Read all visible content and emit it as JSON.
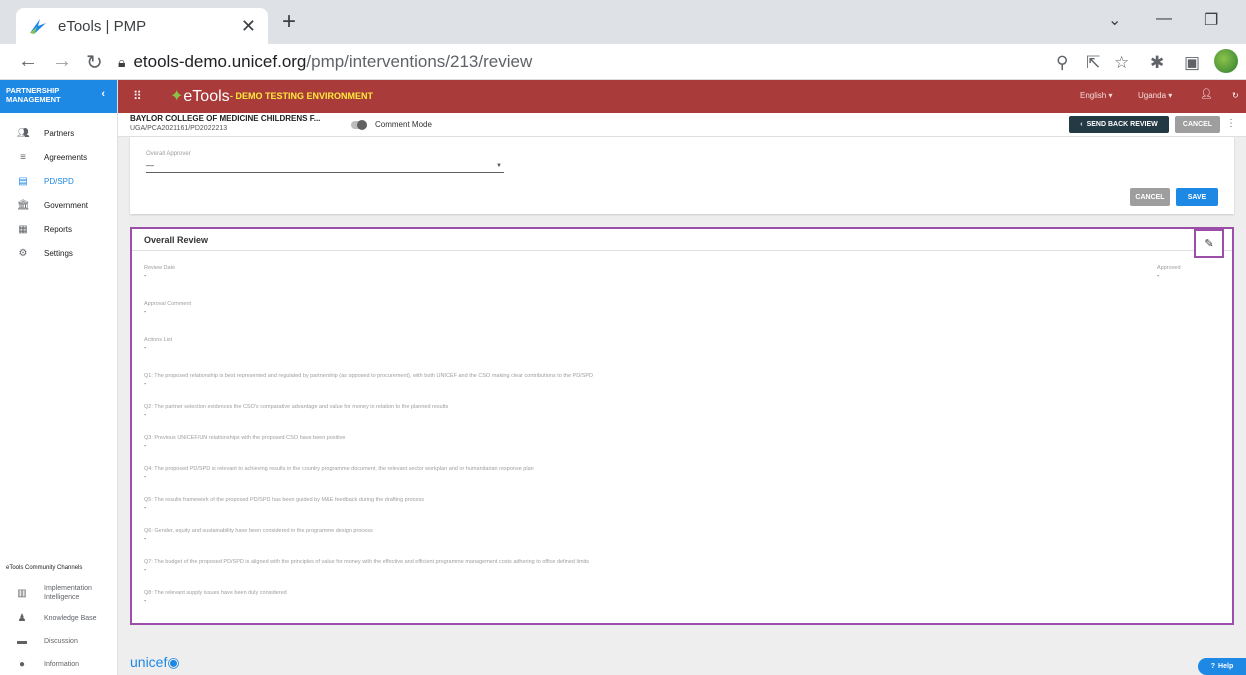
{
  "browser": {
    "tab_title": "eTools | PMP",
    "url_domain": "etools-demo.unicef.org",
    "url_path": "/pmp/interventions/213/review"
  },
  "sidebar": {
    "header": "PARTNERSHIP MANAGEMENT",
    "items": [
      {
        "label": "Partners",
        "icon": "people-icon"
      },
      {
        "label": "Agreements",
        "icon": "agreements-icon"
      },
      {
        "label": "PD/SPD",
        "icon": "document-icon"
      },
      {
        "label": "Government",
        "icon": "bank-icon"
      },
      {
        "label": "Reports",
        "icon": "clipboard-icon"
      },
      {
        "label": "Settings",
        "icon": "gear-icon"
      }
    ],
    "community_title": "eTools Community Channels",
    "footer_items": [
      {
        "label": "Implementation Intelligence"
      },
      {
        "label": "Knowledge Base"
      },
      {
        "label": "Discussion"
      },
      {
        "label": "Information"
      }
    ]
  },
  "header": {
    "logo": "eTools",
    "env": "- DEMO TESTING ENVIRONMENT",
    "language": "English",
    "country": "Uganda"
  },
  "titlebar": {
    "partner": "BAYLOR COLLEGE OF MEDICINE CHILDRENS F...",
    "reference": "UGA/PCA2021161/PD2022213",
    "comment_mode": "Comment Mode",
    "send_back_label": "SEND BACK REVIEW",
    "cancel_label": "CANCEL"
  },
  "approver_card": {
    "label": "Overall Approver",
    "value": "—",
    "cancel_label": "CANCEL",
    "save_label": "SAVE"
  },
  "review": {
    "title": "Overall Review",
    "review_date_label": "Review Date",
    "review_date_value": "-",
    "approved_label": "Approved",
    "approved_value": "-",
    "approval_comment_label": "Approval Comment",
    "approval_comment_value": "-",
    "actions_list_label": "Actions List",
    "actions_list_value": "-",
    "questions": [
      {
        "q": "Q1: The proposed relationship is best represented and regulated by partnership (as opposed to procurement), with both UNICEF and the CSO making clear contributions to the PD/SPD",
        "a": "-"
      },
      {
        "q": "Q2: The partner selection evidences the CSO's comparative advantage and value for money in relation to the planned results",
        "a": "-"
      },
      {
        "q": "Q3: Previous UNICEF/UN relationships with the proposed CSO have been positive",
        "a": "-"
      },
      {
        "q": "Q4: The proposed PD/SPD is relevant to achieving results in the country programme document, the relevant sector workplan and or humanitarian response plan",
        "a": "-"
      },
      {
        "q": "Q5: The results framework of the proposed PD/SPD has been guided by M&E feedback during the drafting process",
        "a": "-"
      },
      {
        "q": "Q6: Gender, equity and sustainability have been considered in the programme design process",
        "a": "-"
      },
      {
        "q": "Q7: The budget of the proposed PD/SPD is aligned with the principles of value for money with the effective and efficient programme management costs adhering to office defined limits",
        "a": "-"
      },
      {
        "q": "Q8: The relevant supply issues have been duly considered",
        "a": "-"
      }
    ]
  },
  "footer": {
    "brand": "unicef",
    "help_label": "Help"
  }
}
